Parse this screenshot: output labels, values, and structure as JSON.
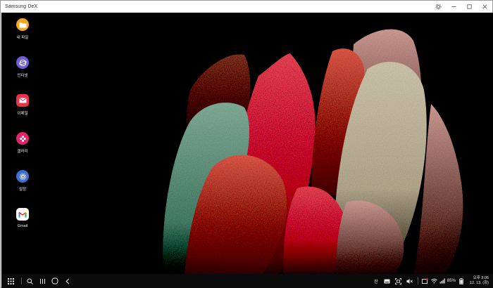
{
  "window": {
    "title": "Samsung DeX",
    "controls": {
      "settings_icon": "gear-icon",
      "minimize_icon": "minimize-icon",
      "maximize_icon": "maximize-icon",
      "close_icon": "close-icon"
    }
  },
  "desktop": {
    "apps": [
      {
        "label": "내 파일",
        "icon": "folder-icon",
        "color": "#f5a623"
      },
      {
        "label": "인터넷",
        "icon": "internet-icon",
        "color": "#6a5fd8"
      },
      {
        "label": "이메일",
        "icon": "email-icon",
        "color": "#e8344a"
      },
      {
        "label": "갤러리",
        "icon": "gallery-icon",
        "color": "#e0246e"
      },
      {
        "label": "설정",
        "icon": "settings-icon",
        "color": "#3c6fd1"
      },
      {
        "label": "Gmail",
        "icon": "gmail-icon",
        "color": "#ffffff"
      }
    ]
  },
  "taskbar": {
    "left": [
      "apps-grid-icon",
      "search-icon",
      "recents-icon",
      "home-icon",
      "back-icon"
    ],
    "tray": {
      "input_mode": "한",
      "battery_percent": "85%",
      "time": "오후 3:05",
      "date": "12. 13. (화)"
    }
  },
  "colors": {
    "taskbar_bg": "#0b0b0b",
    "desktop_bg": "#000000"
  }
}
